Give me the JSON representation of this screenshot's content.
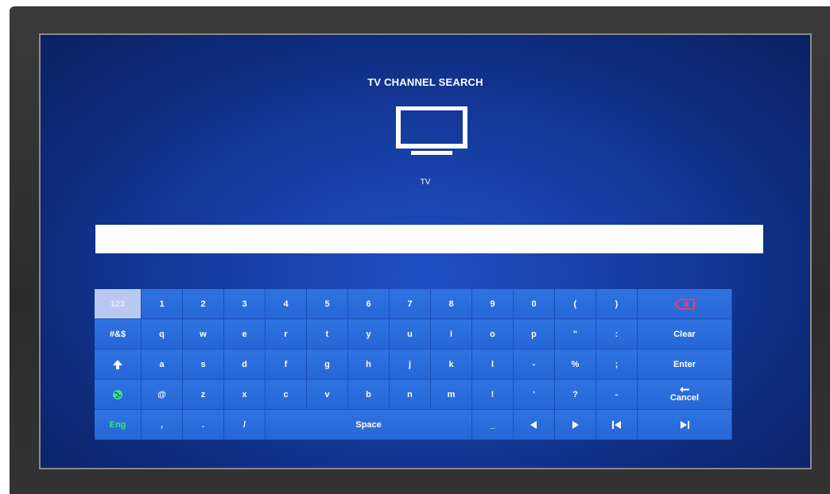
{
  "screen": {
    "title": "TV CHANNEL SEARCH",
    "source_label": "TV",
    "source_icon": "tv-icon"
  },
  "search": {
    "value": "",
    "placeholder": ""
  },
  "keyboard": {
    "rows": [
      [
        {
          "label": "123",
          "name": "key-123",
          "selected": true
        },
        {
          "label": "1",
          "name": "key-1"
        },
        {
          "label": "2",
          "name": "key-2"
        },
        {
          "label": "3",
          "name": "key-3"
        },
        {
          "label": "4",
          "name": "key-4"
        },
        {
          "label": "5",
          "name": "key-5"
        },
        {
          "label": "6",
          "name": "key-6"
        },
        {
          "label": "7",
          "name": "key-7"
        },
        {
          "label": "8",
          "name": "key-8"
        },
        {
          "label": "9",
          "name": "key-9"
        },
        {
          "label": "0",
          "name": "key-0"
        },
        {
          "label": "(",
          "name": "key-open-paren"
        },
        {
          "label": ")",
          "name": "key-close-paren"
        },
        {
          "label": "",
          "name": "backspace-key",
          "icon": "backspace-icon"
        }
      ],
      [
        {
          "label": "#&$",
          "name": "key-symbols"
        },
        {
          "label": "q",
          "name": "key-q"
        },
        {
          "label": "w",
          "name": "key-w"
        },
        {
          "label": "e",
          "name": "key-e"
        },
        {
          "label": "r",
          "name": "key-r"
        },
        {
          "label": "t",
          "name": "key-t"
        },
        {
          "label": "y",
          "name": "key-y"
        },
        {
          "label": "u",
          "name": "key-u"
        },
        {
          "label": "i",
          "name": "key-i"
        },
        {
          "label": "o",
          "name": "key-o"
        },
        {
          "label": "p",
          "name": "key-p"
        },
        {
          "label": "\"",
          "name": "key-quote"
        },
        {
          "label": ":",
          "name": "key-colon"
        },
        {
          "label": "Clear",
          "name": "clear-key"
        }
      ],
      [
        {
          "label": "",
          "name": "shift-key",
          "icon": "shift-arrow-icon"
        },
        {
          "label": "a",
          "name": "key-a"
        },
        {
          "label": "s",
          "name": "key-s"
        },
        {
          "label": "d",
          "name": "key-d"
        },
        {
          "label": "f",
          "name": "key-f"
        },
        {
          "label": "g",
          "name": "key-g"
        },
        {
          "label": "h",
          "name": "key-h"
        },
        {
          "label": "j",
          "name": "key-j"
        },
        {
          "label": "k",
          "name": "key-k"
        },
        {
          "label": "l",
          "name": "key-l"
        },
        {
          "label": "-",
          "name": "key-hyphen"
        },
        {
          "label": "%",
          "name": "key-percent"
        },
        {
          "label": ";",
          "name": "key-semicolon"
        },
        {
          "label": "Enter",
          "name": "enter-key"
        }
      ],
      [
        {
          "label": "",
          "name": "language-globe-key",
          "icon": "globe-icon"
        },
        {
          "label": "@",
          "name": "key-at"
        },
        {
          "label": "z",
          "name": "key-z"
        },
        {
          "label": "x",
          "name": "key-x"
        },
        {
          "label": "c",
          "name": "key-c"
        },
        {
          "label": "v",
          "name": "key-v"
        },
        {
          "label": "b",
          "name": "key-b"
        },
        {
          "label": "n",
          "name": "key-n"
        },
        {
          "label": "m",
          "name": "key-m"
        },
        {
          "label": "!",
          "name": "key-exclamation"
        },
        {
          "label": "'",
          "name": "key-apostrophe"
        },
        {
          "label": "?",
          "name": "key-question"
        },
        {
          "label": "-",
          "name": "key-dash"
        },
        {
          "label": "Cancel",
          "name": "cancel-key",
          "icon": "return-arrow-icon"
        }
      ],
      [
        {
          "label": "Eng",
          "name": "language-key",
          "green": true
        },
        {
          "label": ",",
          "name": "key-comma"
        },
        {
          "label": ".",
          "name": "key-period"
        },
        {
          "label": "/",
          "name": "key-slash"
        },
        {
          "label": "Space",
          "name": "space-key",
          "span": 5
        },
        {
          "label": "_",
          "name": "key-underscore"
        },
        {
          "label": "",
          "name": "cursor-left-key",
          "icon": "triangle-left-icon"
        },
        {
          "label": "",
          "name": "cursor-right-key",
          "icon": "triangle-right-icon"
        },
        {
          "label": "",
          "name": "cursor-start-key",
          "icon": "skip-start-icon"
        },
        {
          "label": "",
          "name": "cursor-end-key",
          "icon": "skip-end-icon"
        }
      ]
    ]
  },
  "colors": {
    "screen_blue": "#1a45b0",
    "key_blue": "#2b6ddb",
    "selected_key": "#b8c8f0",
    "language_green": "#39e67a",
    "backspace_red": "#e0407a"
  }
}
